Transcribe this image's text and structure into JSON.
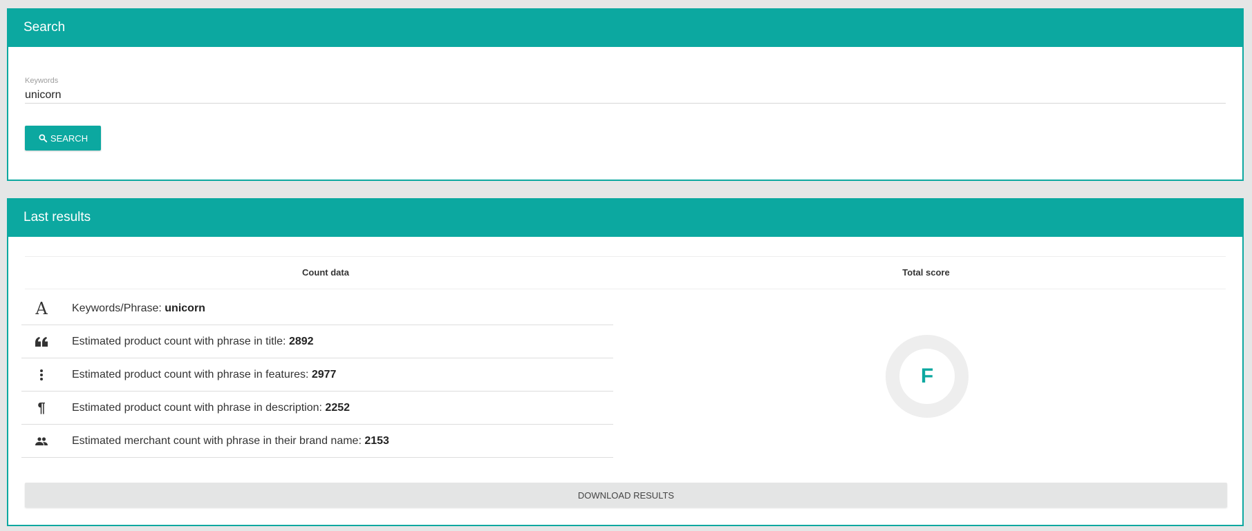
{
  "search_panel": {
    "title": "Search",
    "keywords_label": "Keywords",
    "keywords_value": "unicorn",
    "search_button": "SEARCH"
  },
  "results_panel": {
    "title": "Last results",
    "col_count": "Count data",
    "col_score": "Total score",
    "rows": [
      {
        "icon": "font-letter-icon",
        "label": "Keywords/Phrase: ",
        "value": "unicorn"
      },
      {
        "icon": "quote-icon",
        "label": "Estimated product count with phrase in title: ",
        "value": "2892"
      },
      {
        "icon": "vertical-dots-icon",
        "label": "Estimated product count with phrase in features: ",
        "value": "2977"
      },
      {
        "icon": "paragraph-icon",
        "label": "Estimated product count with phrase in description: ",
        "value": "2252"
      },
      {
        "icon": "people-icon",
        "label": "Estimated merchant count with phrase in their brand name: ",
        "value": "2153"
      }
    ],
    "score": "F",
    "download_button": "DOWNLOAD RESULTS"
  },
  "colors": {
    "accent": "#0ca8a0",
    "background": "#e5e6e6"
  }
}
